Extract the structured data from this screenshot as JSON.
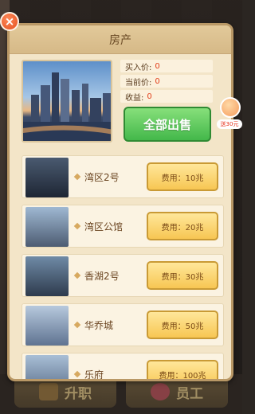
{
  "modal": {
    "title": "房产",
    "close_glyph": "×"
  },
  "summary": {
    "buy_price_label": "买入价:",
    "buy_price_value": "0",
    "current_price_label": "当前价:",
    "current_price_value": "0",
    "profit_label": "收益:",
    "profit_value": "0",
    "sell_all_label": "全部出售"
  },
  "properties": [
    {
      "name": "湾区2号",
      "cost": "费用：10兆"
    },
    {
      "name": "湾区公馆",
      "cost": "费用：20兆"
    },
    {
      "name": "香湖2号",
      "cost": "费用：30兆"
    },
    {
      "name": "华乔城",
      "cost": "费用：50兆"
    },
    {
      "name": "乐府",
      "cost": "费用：100兆"
    }
  ],
  "side_bubble": {
    "label": "送30元"
  },
  "bottom_bar": {
    "left_label": "升职",
    "right_label": "员工"
  },
  "colors": {
    "accent_orange": "#e4501e",
    "sell_green": "#43b84a",
    "cost_yellow": "#f7c653",
    "value_red": "#e2401c"
  }
}
